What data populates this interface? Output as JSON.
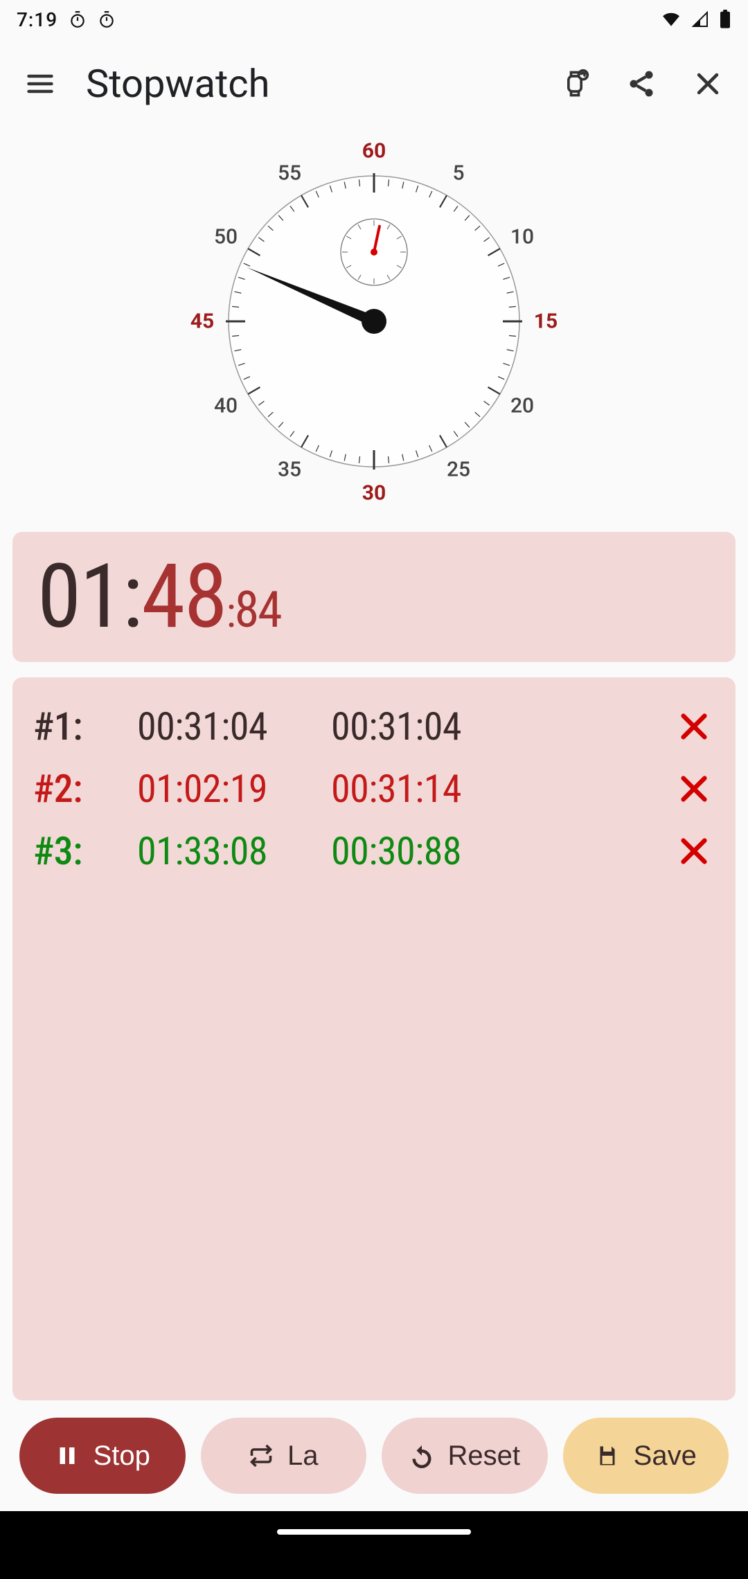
{
  "status": {
    "time": "7:19",
    "icons": [
      "stopwatch-small",
      "stopwatch-small"
    ]
  },
  "appbar": {
    "title": "Stopwatch"
  },
  "dial": {
    "numbers": {
      "n60": "60",
      "n5": "5",
      "n10": "10",
      "n15": "15",
      "n20": "20",
      "n25": "25",
      "n30": "30",
      "n35": "35",
      "n40": "40",
      "n45": "45",
      "n50": "50",
      "n55": "55"
    }
  },
  "elapsed": {
    "mm": "01",
    "colon": ":",
    "ss": "48",
    "cscolon": ":",
    "cs": "84"
  },
  "laps": [
    {
      "idx": "#1:",
      "total": "00:31:04",
      "split": "00:31:04",
      "tone": "default"
    },
    {
      "idx": "#2:",
      "total": "01:02:19",
      "split": "00:31:14",
      "tone": "red"
    },
    {
      "idx": "#3:",
      "total": "01:33:08",
      "split": "00:30:88",
      "tone": "green"
    }
  ],
  "actions": {
    "stop": "Stop",
    "lap": "La",
    "reset": "Reset",
    "save": "Save"
  }
}
